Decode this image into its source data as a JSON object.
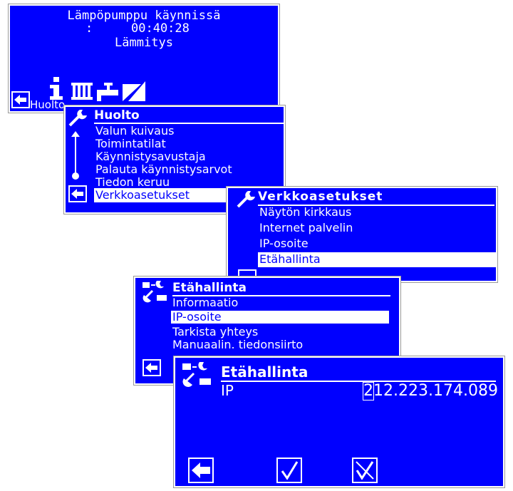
{
  "screen1": {
    "status_line": "Lämpöpumppu käynnissä",
    "timer_label": ":",
    "timer_value": "00:40:28",
    "mode": "Lämmitys",
    "bottom_label": "Huolto",
    "icons": [
      "info-icon",
      "radiator-icon",
      "tap-water-icon",
      "cooling-icon"
    ]
  },
  "screen2": {
    "title": "Huolto",
    "items": [
      "Valun kuivaus",
      "Toimintatilat",
      "Käynnistysavustaja",
      "Palauta käynnistysarvot",
      "Tiedon keruu",
      "Verkkoasetukset"
    ]
  },
  "screen3": {
    "title": "Verkkoasetukset",
    "items": [
      "Näytön kirkkaus",
      "Internet palvelin",
      "IP-osoite",
      "Etähallinta"
    ]
  },
  "screen4": {
    "title": "Etähallinta",
    "items": [
      "Informaatio",
      "IP-osoite",
      "Tarkista yhteys",
      "Manuaalin. tiedonsiirto"
    ]
  },
  "screen5": {
    "title": "Etähallinta",
    "ip_label": "IP",
    "ip_value": "212.223.174.089"
  },
  "colors": {
    "screen_bg": "#0000ff",
    "text": "#ffffff"
  }
}
